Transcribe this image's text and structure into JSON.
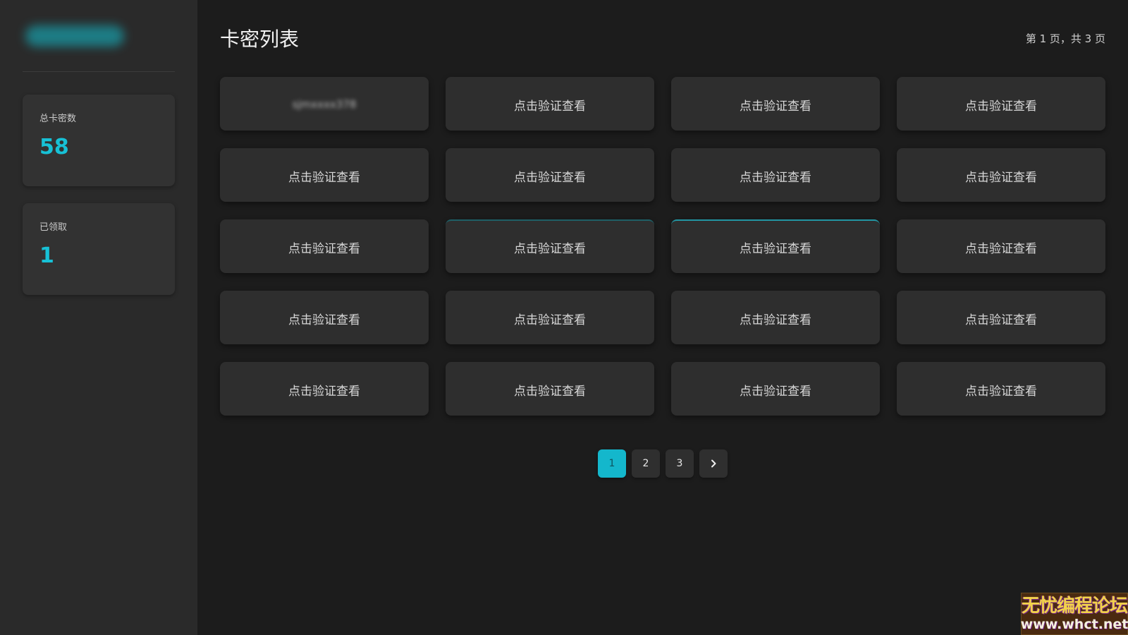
{
  "sidebar": {
    "stats": [
      {
        "label": "总卡密数",
        "value": "58"
      },
      {
        "label": "已领取",
        "value": "1"
      }
    ]
  },
  "main": {
    "title": "卡密列表",
    "page_info": "第 1 页，共 3 页",
    "cards": [
      "sjmxxxx378",
      "点击验证查看",
      "点击验证查看",
      "点击验证查看",
      "点击验证查看",
      "点击验证查看",
      "点击验证查看",
      "点击验证查看",
      "点击验证查看",
      "点击验证查看",
      "点击验证查看",
      "点击验证查看",
      "点击验证查看",
      "点击验证查看",
      "点击验证查看",
      "点击验证查看",
      "点击验证查看",
      "点击验证查看",
      "点击验证查看",
      "点击验证查看"
    ]
  },
  "pagination": {
    "pages": [
      "1",
      "2",
      "3"
    ],
    "current": "1",
    "next_icon": "chevron-right-icon"
  },
  "watermark": {
    "cn": "无忧编程论坛",
    "url": "www.whct.net"
  },
  "colors": {
    "accent": "#14b7cc",
    "background": "#1c1c1c",
    "sidebar": "#2a2a2a",
    "card": "#2e2e2e"
  }
}
